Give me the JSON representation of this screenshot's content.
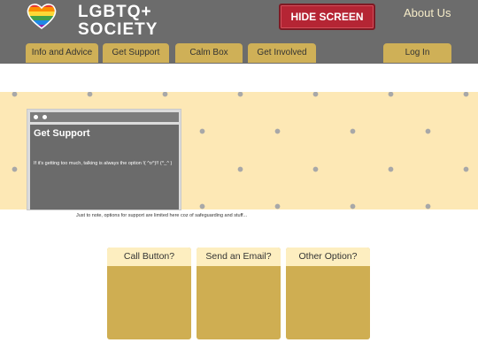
{
  "header": {
    "logo_text_line1": "LGBTQ+",
    "logo_text_line2": "SOCIETY",
    "hide_button": "HIDE SCREEN",
    "about_link": "About Us"
  },
  "nav": {
    "tabs": [
      {
        "label": "Info and Advice"
      },
      {
        "label": "Get Support"
      },
      {
        "label": "Calm Box"
      },
      {
        "label": "Get Involved"
      }
    ],
    "login": "Log In"
  },
  "hero_window": {
    "title": "Get Support",
    "text": "If it's getting too much, talking is always the option !( ^o^)!! (^_^ )"
  },
  "note": "Just to note, options for support are limited here coz of safeguarding and stuff...",
  "cards": [
    {
      "label": "Call Button?"
    },
    {
      "label": "Send an Email?"
    },
    {
      "label": "Other Option?"
    }
  ],
  "colors": {
    "header_bg": "#6c6c6c",
    "accent_gold": "#cfb057",
    "banner_cream": "#fde8b5",
    "hide_red": "#b52534"
  }
}
